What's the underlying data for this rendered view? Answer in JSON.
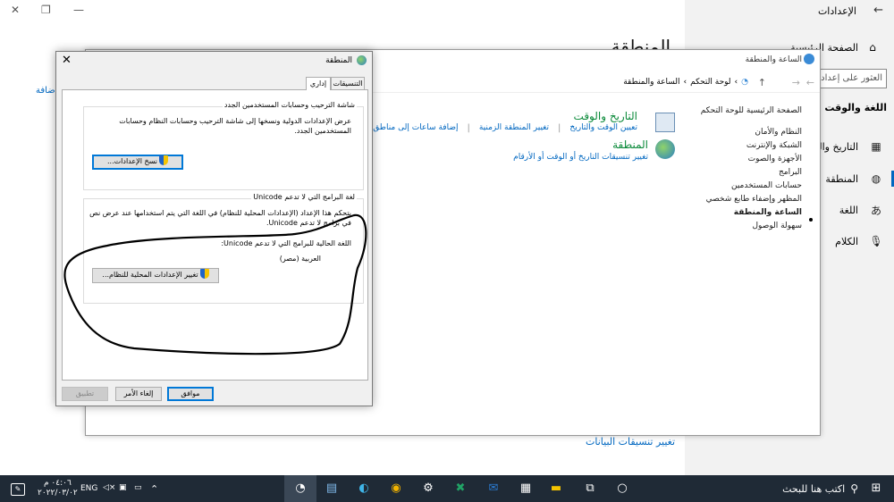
{
  "settings": {
    "title": "الإعدادات",
    "home": "الصفحة الرئيسية",
    "search_placeholder": "العثور على إعداد",
    "category": "اللغة والوقت",
    "nav": [
      {
        "label": "التاريخ والوقت",
        "icon": "calendar-clock-icon"
      },
      {
        "label": "المنطقة",
        "icon": "globe-icon"
      },
      {
        "label": "اللغة",
        "icon": "language-icon"
      },
      {
        "label": "الكلام",
        "icon": "microphone-icon"
      }
    ],
    "page_title": "المنطقة",
    "link_add": "إضافة",
    "link_bottom": "تغيير تنسيقات البيانات"
  },
  "control_panel": {
    "title": "الساعة والمنطقة",
    "breadcrumb": [
      "لوحة التحكم",
      "الساعة والمنطقة"
    ],
    "side_home": "الصفحة الرئيسية للوحة التحكم",
    "side_links": [
      "النظام والأمان",
      "الشبكة والإنترنت",
      "الأجهزة والصوت",
      "البرامج",
      "حسابات المستخدمين",
      "المظهر وإضفاء طابع شخصي",
      "الساعة والمنطقة",
      "سهولة الوصول"
    ],
    "cat1_title": "التاريخ والوقت",
    "cat1_links": [
      "تعيين الوقت والتاريخ",
      "تغيير المنطقة الزمنية",
      "إضافة ساعات إلى مناطق زمنية مختلفة"
    ],
    "cat2_title": "المنطقة",
    "cat2_link": "تغيير تنسيقات التاريخ أو الوقت أو الأرقام"
  },
  "dialog": {
    "title": "المنطقة",
    "tabs": [
      "التنسيقات",
      "إداري"
    ],
    "group1_label": "شاشة الترحيب وحسابات المستخدمين الجدد",
    "group1_text": "عرض الإعدادات الدولية ونسخها إلى شاشة الترحيب وحسابات النظام وحسابات المستخدمين الجدد.",
    "copy_button": "نسخ الإعدادات...",
    "group2_label": "لغة البرامج التي لا تدعم Unicode",
    "group2_text": "يتحكم هذا الإعداد (الإعدادات المحلية للنظام) في اللغة التي يتم استخدامها عند عرض نص في برامج لا تدعم Unicode.",
    "current_label": "اللغة الحالية للبرامج التي لا تدعم Unicode:",
    "current_value": "العربية (مصر)",
    "change_button": "تغيير الإعدادات المحلية للنظام...",
    "ok": "موافق",
    "cancel": "إلغاء الأمر",
    "apply": "تطبيق"
  },
  "taskbar": {
    "search": "اكتب هنا للبحث",
    "lang": "ENG",
    "time": "٠٤:٠٦ م",
    "date": "٢٠٢٢/٠٣/٠٢"
  },
  "colors": {
    "accent": "#0067c0",
    "taskbar": "#1f2a36",
    "green_title": "#0b8a3a"
  }
}
